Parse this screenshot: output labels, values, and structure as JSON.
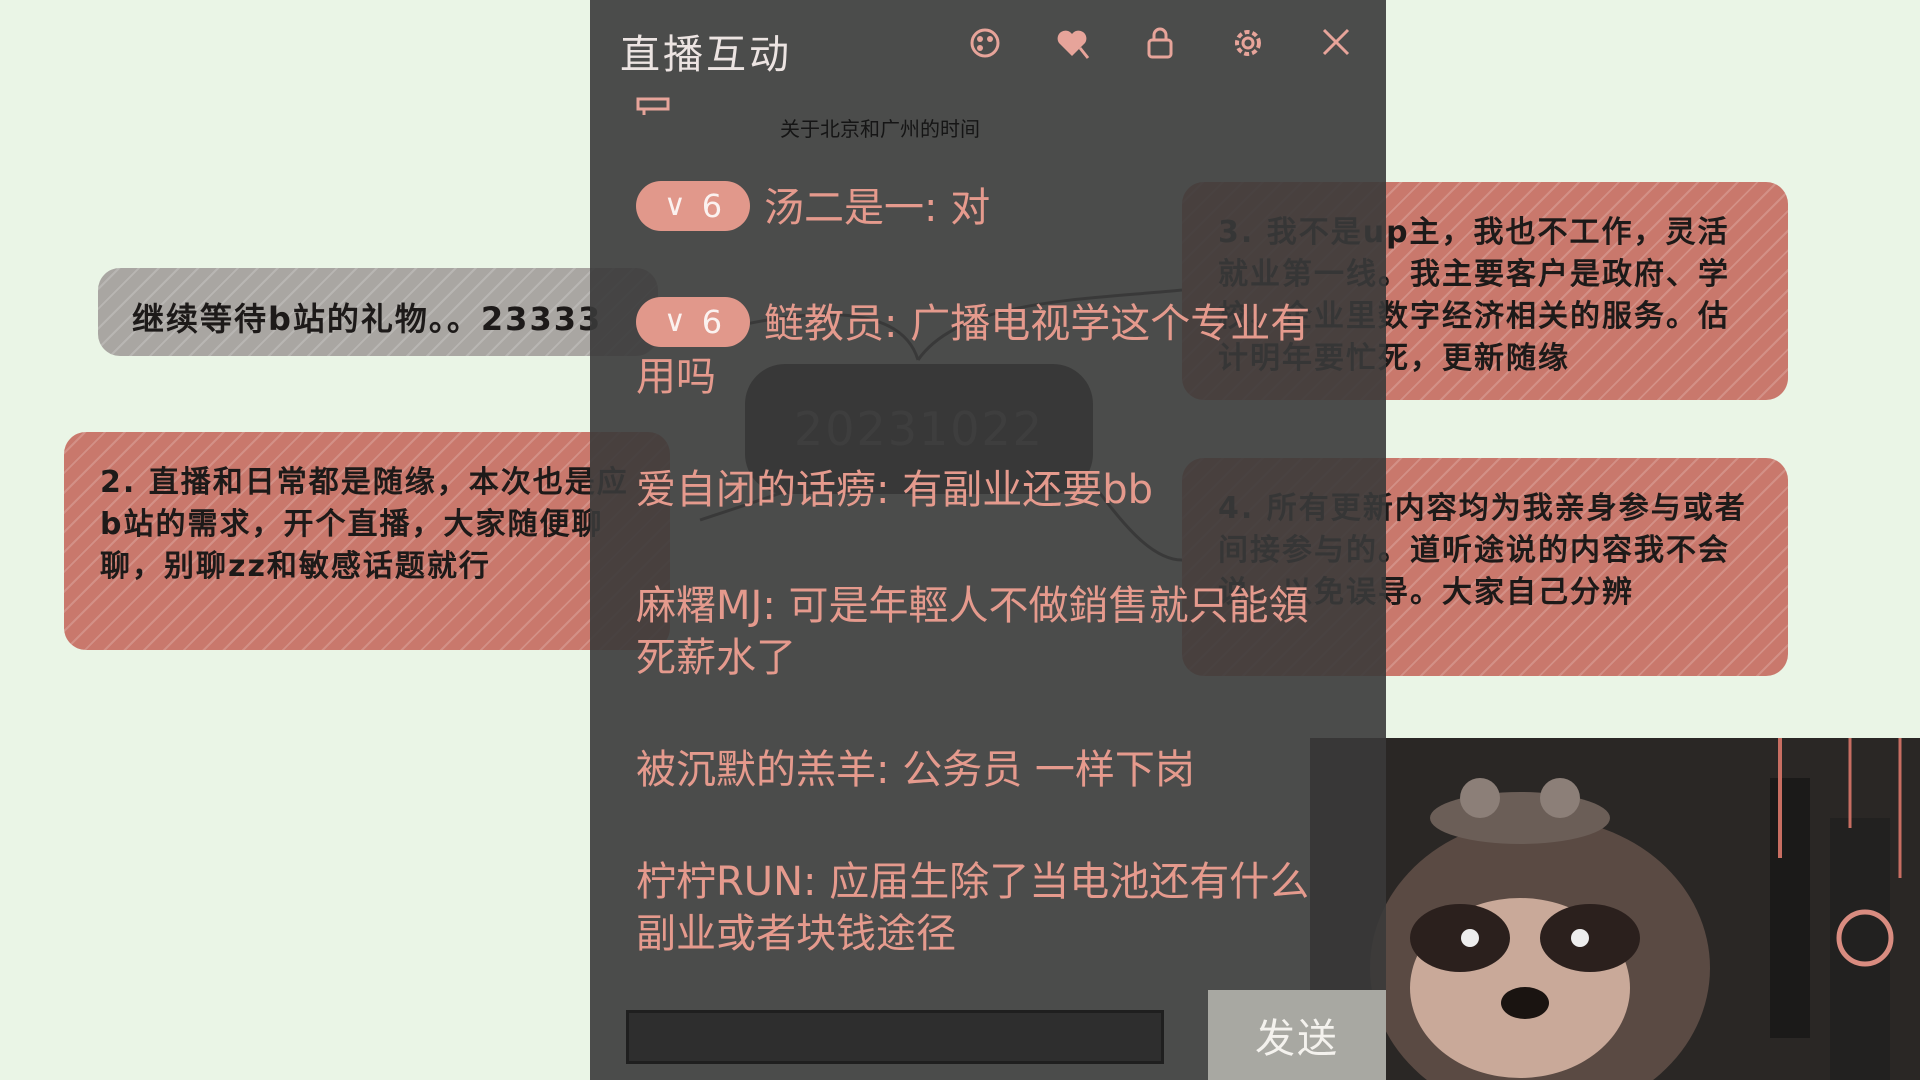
{
  "notes": {
    "note1": "继续等待b站的礼物。。23333",
    "note2": "2. 直播和日常都是随缘，本次也是应b站的需求，开个直播，大家随便聊聊，别聊zz和敏感话题就行",
    "note3": "3. 我不是up主，我也不工作，灵活就业第一线。我主要客户是政府、学校、企业里数字经济相关的服务。估计明年要忙死，更新随缘",
    "note4": "4. 所有更新内容均为我亲身参与或者间接参与的。道听途说的内容我不会说，以免误导。大家自己分辨"
  },
  "mindmap": {
    "center_label": "20231022"
  },
  "panel": {
    "title": "直播互动",
    "pinned_topic": "关于北京和广州的时间",
    "messages": [
      {
        "badge": "6",
        "user": "汤二是一",
        "text": "对"
      },
      {
        "badge": "6",
        "user": "鲢教员",
        "text": "广播电视学这个专业有用吗"
      },
      {
        "badge": "",
        "user": "爱自闭的话痨",
        "text": "有副业还要bb"
      },
      {
        "badge": "",
        "user": "麻糬MJ",
        "text": "可是年輕人不做銷售就只能領死薪水了"
      },
      {
        "badge": "",
        "user": "被沉默的羔羊",
        "text": "公务员 一样下岗"
      },
      {
        "badge": "",
        "user": "柠柠RUN",
        "text": "应届生除了当电池还有什么副业或者块钱途径"
      }
    ],
    "send_label": "发送",
    "input_value": ""
  },
  "colors": {
    "note_red": "#c9786c",
    "note_gray": "#a9a6a2",
    "panel_bg": "#3a3a3a",
    "message_text": "#e59a8d",
    "badge_bg": "#e1988b",
    "send_button": "#a8a8a2",
    "page_bg": "#eaf5e6"
  },
  "icons": {
    "toolbar": [
      "palette-icon",
      "heart-slash-icon",
      "lock-icon",
      "gear-icon",
      "close-icon"
    ],
    "pin": "pin-icon",
    "badge_chevron": "chevron-down-icon"
  }
}
